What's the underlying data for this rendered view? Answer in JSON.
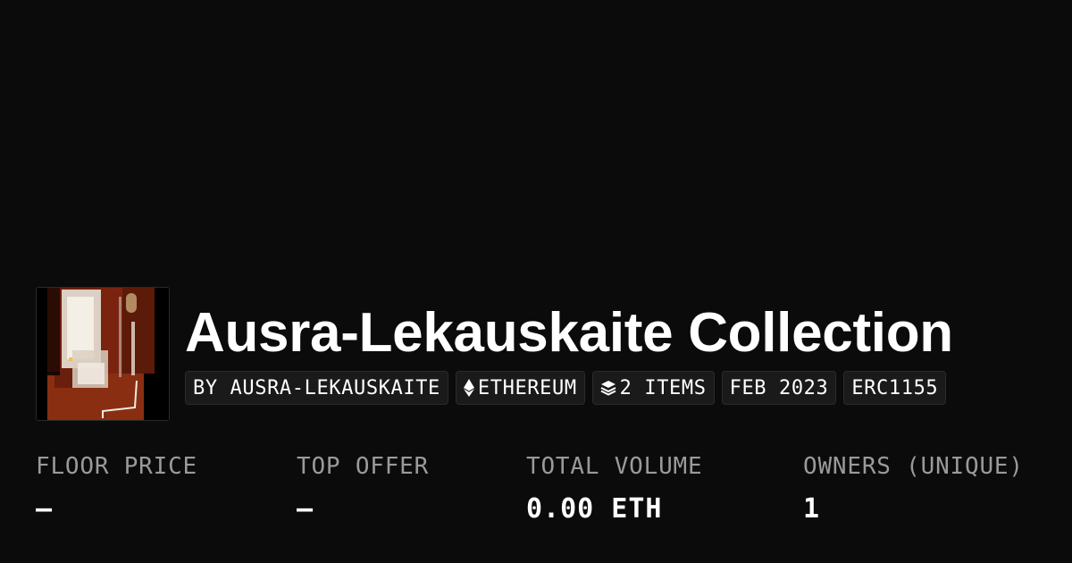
{
  "collection": {
    "title": "Ausra-Lekauskaite Collection",
    "avatar_icon": "artwork-thumbnail"
  },
  "badges": {
    "creator": "BY AUSRA-LEKAUSKAITE",
    "chain": "ETHEREUM",
    "chain_icon": "ethereum-icon",
    "items": "2 ITEMS",
    "items_icon": "layers-icon",
    "date": "FEB 2023",
    "standard": "ERC1155"
  },
  "stats": {
    "floor_price": {
      "label": "FLOOR PRICE",
      "value": "–"
    },
    "top_offer": {
      "label": "TOP OFFER",
      "value": "–"
    },
    "total_volume": {
      "label": "TOTAL VOLUME",
      "value": "0.00 ETH"
    },
    "owners": {
      "label": "OWNERS (UNIQUE)",
      "value": "1"
    }
  },
  "colors": {
    "background": "#0b0b0b",
    "badge_background": "#1a1a1a",
    "label_gray": "#9a9a9a",
    "text": "#ffffff"
  }
}
